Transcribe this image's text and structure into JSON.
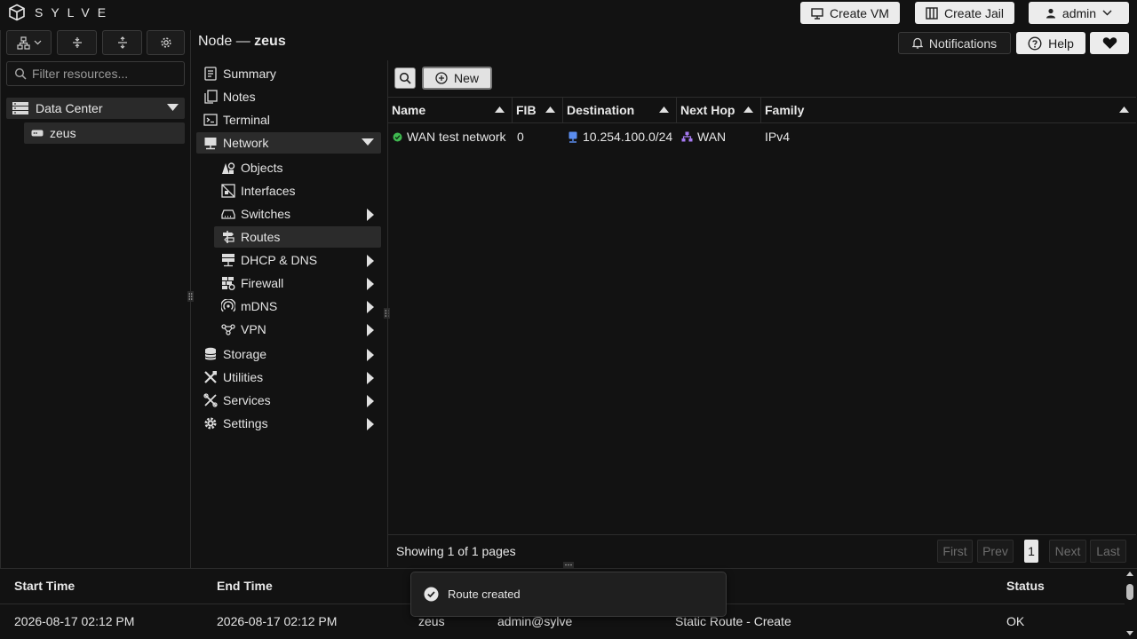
{
  "app": {
    "title": "SYLVE"
  },
  "topbar": {
    "create_vm": "Create VM",
    "create_jail": "Create Jail",
    "user": "admin"
  },
  "header": {
    "node_prefix": "Node —",
    "node_name": "zeus",
    "notifications": "Notifications",
    "help": "Help"
  },
  "left": {
    "filter_placeholder": "Filter resources...",
    "tree": {
      "datacenter": "Data Center",
      "node": "zeus"
    }
  },
  "nav": {
    "items": [
      {
        "label": "Summary",
        "icon": "summary-icon"
      },
      {
        "label": "Notes",
        "icon": "notes-icon"
      },
      {
        "label": "Terminal",
        "icon": "terminal-icon"
      },
      {
        "label": "Network",
        "icon": "network-icon",
        "expanded": true
      },
      {
        "label": "Objects",
        "icon": "objects-icon"
      },
      {
        "label": "Interfaces",
        "icon": "interfaces-icon"
      },
      {
        "label": "Switches",
        "icon": "switches-icon"
      },
      {
        "label": "Routes",
        "icon": "routes-icon",
        "active": true
      },
      {
        "label": "DHCP & DNS",
        "icon": "dhcp-icon"
      },
      {
        "label": "Firewall",
        "icon": "firewall-icon"
      },
      {
        "label": "mDNS",
        "icon": "mdns-icon"
      },
      {
        "label": "VPN",
        "icon": "vpn-icon"
      },
      {
        "label": "Storage",
        "icon": "storage-icon"
      },
      {
        "label": "Utilities",
        "icon": "utilities-icon"
      },
      {
        "label": "Services",
        "icon": "services-icon"
      },
      {
        "label": "Settings",
        "icon": "settings-icon"
      }
    ]
  },
  "toolbar": {
    "new_label": "New"
  },
  "table": {
    "columns": [
      "Name",
      "FIB",
      "Destination",
      "Next Hop",
      "Family"
    ],
    "rows": [
      {
        "name": "WAN test network",
        "fib": "0",
        "destination": "10.254.100.0/24",
        "next_hop": "WAN",
        "family": "IPv4"
      }
    ]
  },
  "pagination": {
    "summary": "Showing 1 of 1 pages",
    "first": "First",
    "prev": "Prev",
    "page": "1",
    "next": "Next",
    "last": "Last"
  },
  "log": {
    "columns": [
      "Start Time",
      "End Time",
      "Status"
    ],
    "rows": [
      {
        "start": "2026-08-17 02:12 PM",
        "end": "2026-08-17 02:12 PM",
        "node": "zeus",
        "user": "admin@sylve",
        "description": "Static Route - Create",
        "status": "OK"
      }
    ]
  },
  "toast": {
    "message": "Route created"
  },
  "colors": {
    "bg": "#121212",
    "button_light": "#ececec",
    "success": "#3fb950",
    "accent_blue": "#5b8def",
    "accent_purple": "#a77bf3"
  }
}
